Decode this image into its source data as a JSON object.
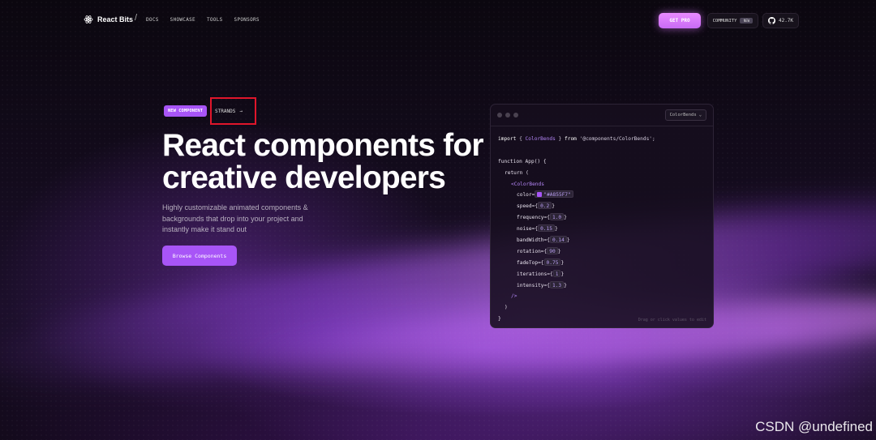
{
  "nav": {
    "brand": "React Bits",
    "separator": "/",
    "links": [
      "DOCS",
      "SHOWCASE",
      "TOOLS",
      "SPONSORS"
    ],
    "pro_label": "GET PRO",
    "community_label": "COMMUNITY",
    "community_badge": "NEW",
    "github_stars": "42.7K"
  },
  "hero": {
    "badge_new": "NEW COMPONENT",
    "badge_link": "STRANDS",
    "badge_arrow": "→",
    "title_line1": "React components for",
    "title_line2": "creative developers",
    "subtitle": "Highly customizable animated components & backgrounds that drop into your project and instantly make it stand out",
    "cta": "Browse Components"
  },
  "code_panel": {
    "select_label": "ColorBends",
    "select_chevron": "⌄",
    "import_kw": "import",
    "import_open": " { ",
    "import_name": "ColorBends",
    "import_close": " } ",
    "from_kw": "from",
    "import_path": " '@components/ColorBends';",
    "fn_line": "function App() {",
    "return_line": "return (",
    "component_open": "<ColorBends",
    "props": [
      {
        "name": "color=",
        "value": "\"#A855F7\""
      },
      {
        "name": "speed={",
        "value": "0.2"
      },
      {
        "name": "frequency={",
        "value": "1.0"
      },
      {
        "name": "noise={",
        "value": "0.15"
      },
      {
        "name": "bandWidth={",
        "value": "0.14"
      },
      {
        "name": "rotation={",
        "value": "90"
      },
      {
        "name": "fadeTop={",
        "value": "0.75"
      },
      {
        "name": "iterations={",
        "value": "1"
      },
      {
        "name": "intensity={",
        "value": "1.3"
      }
    ],
    "prop_close": "}",
    "component_close": "/>",
    "paren_close": ")",
    "brace_close": "}",
    "hint": "Drag or click values to edit"
  },
  "colors": {
    "accent": "#A855F7",
    "highlight_box": "#E0162B"
  },
  "watermark": "CSDN @undefined"
}
